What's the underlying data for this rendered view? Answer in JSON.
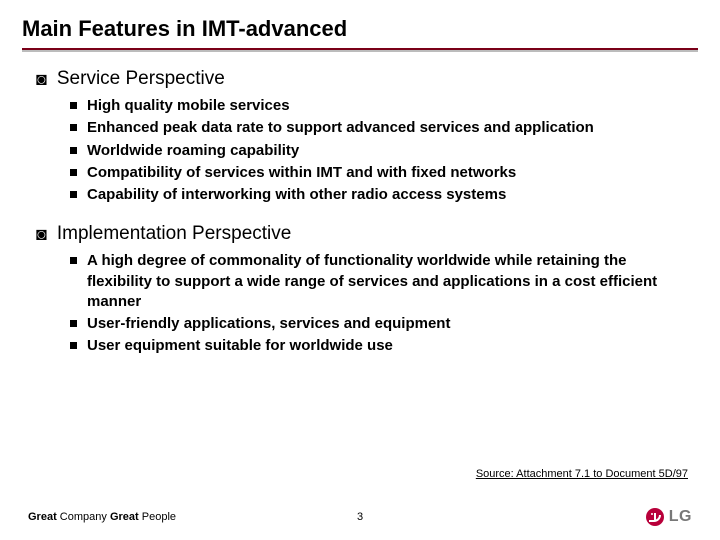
{
  "title": "Main Features in IMT-advanced",
  "sections": [
    {
      "heading": "Service Perspective",
      "items": [
        "High quality mobile services",
        "Enhanced peak data rate to support advanced services and application",
        "Worldwide roaming capability",
        "Compatibility of services within IMT and with fixed networks",
        "Capability of interworking with other radio access systems"
      ]
    },
    {
      "heading": "Implementation Perspective",
      "items": [
        "A high degree of commonality of functionality worldwide while retaining the flexibility to support a wide range of services and applications in a cost efficient manner",
        "User-friendly applications, services and equipment",
        "User equipment suitable for worldwide use"
      ]
    }
  ],
  "source": "Source: Attachment 7.1 to Document 5D/97",
  "footer": {
    "left_bold1": "Great",
    "left_plain1": " Company ",
    "left_bold2": "Great",
    "left_plain2": " People",
    "page": "3",
    "logo_text": "LG"
  },
  "glyphs": {
    "outer_bullet": "◙",
    "inner_bullet": ""
  }
}
